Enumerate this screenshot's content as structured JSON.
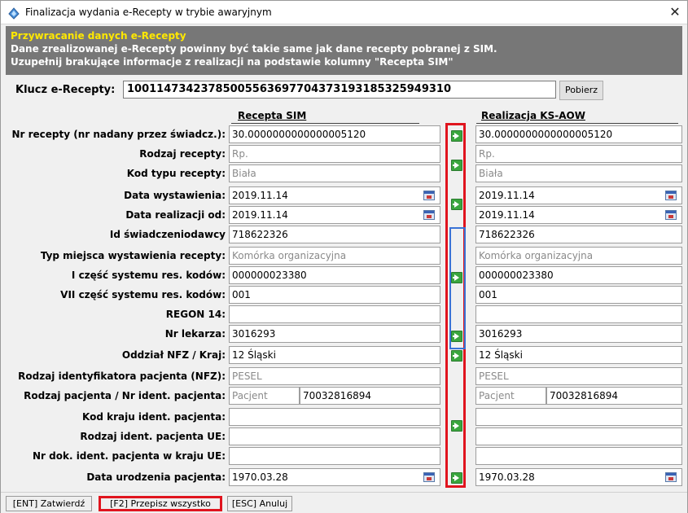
{
  "window": {
    "title": "Finalizacja wydania e-Recepty w trybie awaryjnym",
    "close_glyph": "✕"
  },
  "banner": {
    "heading": "Przywracanie danych e-Recepty",
    "line1": "Dane zrealizowanej e-Recepty powinny być takie same jak dane recepty pobranej z SIM.",
    "line2": "Uzupełnij brakujące informacje z realizacji na podstawie kolumny \"Recepta SIM\""
  },
  "key": {
    "label": "Klucz e-Recepty:",
    "value": "10011473423785005563697704373193185325949310",
    "fetch_button": "Pobierz"
  },
  "columns": {
    "sim": "Recepta SIM",
    "real": "Realizacja KS-AOW"
  },
  "rows": [
    {
      "label": "Nr recepty (nr nadany przez świadcz.):",
      "sim": "30.0000000000000005120",
      "real": "30.0000000000000005120"
    },
    {
      "label": "Rodzaj recepty:",
      "sim": "Rp.",
      "real": "Rp."
    },
    {
      "label": "Kod typu recepty:",
      "sim": "Biała",
      "real": "Biała"
    },
    {
      "label": "Data wystawienia:",
      "sim": "2019.11.14",
      "real": "2019.11.14"
    },
    {
      "label": "Data realizacji od:",
      "sim": "2019.11.14",
      "real": "2019.11.14"
    },
    {
      "label": "Id świadczeniodawcy",
      "sim": "718622326",
      "real": "718622326"
    },
    {
      "label": "Typ miejsca wystawienia recepty:",
      "sim": "Komórka organizacyjna",
      "real": "Komórka organizacyjna"
    },
    {
      "label": "I część systemu res. kodów:",
      "sim": "000000023380",
      "real": "000000023380"
    },
    {
      "label": "VII część systemu res. kodów:",
      "sim": "001",
      "real": "001"
    },
    {
      "label": "REGON 14:",
      "sim": "",
      "real": ""
    },
    {
      "label": "Nr lekarza:",
      "sim": "3016293",
      "real": "3016293"
    },
    {
      "label": "Oddział NFZ / Kraj:",
      "sim": "12 Śląski",
      "real": "12 Śląski"
    },
    {
      "label": "Rodzaj identyfikatora pacjenta (NFZ):",
      "sim": "PESEL",
      "real": "PESEL"
    },
    {
      "label": "Rodzaj pacjenta / Nr ident. pacjenta:",
      "sim": "Pacjent",
      "sim2": "70032816894",
      "real": "Pacjent",
      "real2": "70032816894"
    },
    {
      "label": "Kod kraju ident. pacjenta:",
      "sim": "",
      "real": ""
    },
    {
      "label": "Rodzaj  ident. pacjenta UE:",
      "sim": "",
      "real": ""
    },
    {
      "label": "Nr dok. ident. pacjenta w kraju UE:",
      "sim": "",
      "real": ""
    },
    {
      "label": "Data urodzenia pacjenta:",
      "sim": "1970.03.28",
      "real": "1970.03.28"
    }
  ],
  "footer": {
    "confirm": "[ENT] Zatwierdź",
    "copy_all": "[F2] Przepisz wszystko",
    "cancel": "[ESC] Anuluj"
  },
  "colors": {
    "highlight": "#e0141e",
    "banner_bg": "#777777",
    "banner_heading": "#ffe800",
    "arrow": "#3aa63e",
    "group": "#3a73d6"
  },
  "icons": {
    "app": "prescription-app-icon",
    "calendar": "calendar-icon",
    "arrow": "arrow-right-icon"
  }
}
